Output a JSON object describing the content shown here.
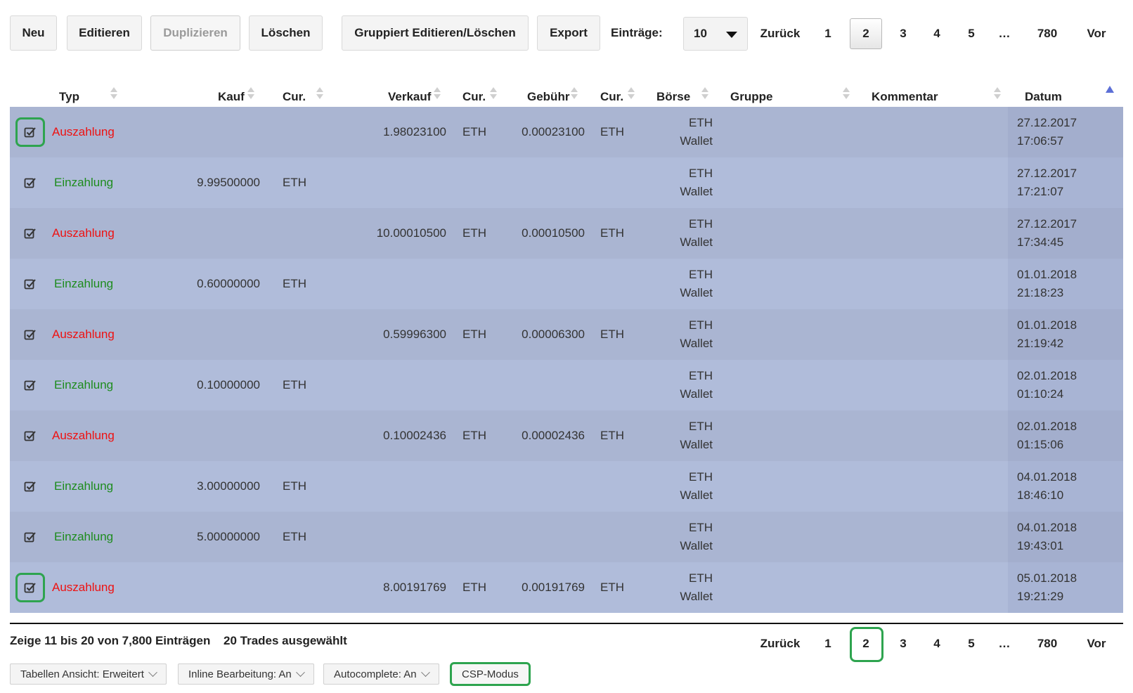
{
  "toolbar": {
    "new": "Neu",
    "edit": "Editieren",
    "duplicate": "Duplizieren",
    "delete": "Löschen",
    "group_edit": "Gruppiert Editieren/Löschen",
    "export": "Export",
    "entries_label": "Einträge:",
    "entries_value": "10"
  },
  "pagination": {
    "prev": "Zurück",
    "next": "Vor",
    "pages": [
      "1",
      "2",
      "3",
      "4",
      "5",
      "…",
      "780"
    ],
    "current": "2"
  },
  "columns": {
    "typ": "Typ",
    "kauf": "Kauf",
    "cur1": "Cur.",
    "verkauf": "Verkauf",
    "cur2": "Cur.",
    "gebuehr": "Gebühr",
    "cur3": "Cur.",
    "boerse": "Börse",
    "gruppe": "Gruppe",
    "kommentar": "Kommentar",
    "datum": "Datum"
  },
  "rows": [
    {
      "typ": "Auszahlung",
      "kauf": "",
      "cur1": "",
      "verkauf": "1.98023100",
      "cur2": "ETH",
      "gebuehr": "0.00023100",
      "cur3": "ETH",
      "boerse1": "ETH",
      "boerse2": "Wallet",
      "date": "27.12.2017",
      "time": "17:06:57"
    },
    {
      "typ": "Einzahlung",
      "kauf": "9.99500000",
      "cur1": "ETH",
      "verkauf": "",
      "cur2": "",
      "gebuehr": "",
      "cur3": "",
      "boerse1": "ETH",
      "boerse2": "Wallet",
      "date": "27.12.2017",
      "time": "17:21:07"
    },
    {
      "typ": "Auszahlung",
      "kauf": "",
      "cur1": "",
      "verkauf": "10.00010500",
      "cur2": "ETH",
      "gebuehr": "0.00010500",
      "cur3": "ETH",
      "boerse1": "ETH",
      "boerse2": "Wallet",
      "date": "27.12.2017",
      "time": "17:34:45"
    },
    {
      "typ": "Einzahlung",
      "kauf": "0.60000000",
      "cur1": "ETH",
      "verkauf": "",
      "cur2": "",
      "gebuehr": "",
      "cur3": "",
      "boerse1": "ETH",
      "boerse2": "Wallet",
      "date": "01.01.2018",
      "time": "21:18:23"
    },
    {
      "typ": "Auszahlung",
      "kauf": "",
      "cur1": "",
      "verkauf": "0.59996300",
      "cur2": "ETH",
      "gebuehr": "0.00006300",
      "cur3": "ETH",
      "boerse1": "ETH",
      "boerse2": "Wallet",
      "date": "01.01.2018",
      "time": "21:19:42"
    },
    {
      "typ": "Einzahlung",
      "kauf": "0.10000000",
      "cur1": "ETH",
      "verkauf": "",
      "cur2": "",
      "gebuehr": "",
      "cur3": "",
      "boerse1": "ETH",
      "boerse2": "Wallet",
      "date": "02.01.2018",
      "time": "01:10:24"
    },
    {
      "typ": "Auszahlung",
      "kauf": "",
      "cur1": "",
      "verkauf": "0.10002436",
      "cur2": "ETH",
      "gebuehr": "0.00002436",
      "cur3": "ETH",
      "boerse1": "ETH",
      "boerse2": "Wallet",
      "date": "02.01.2018",
      "time": "01:15:06"
    },
    {
      "typ": "Einzahlung",
      "kauf": "3.00000000",
      "cur1": "ETH",
      "verkauf": "",
      "cur2": "",
      "gebuehr": "",
      "cur3": "",
      "boerse1": "ETH",
      "boerse2": "Wallet",
      "date": "04.01.2018",
      "time": "18:46:10"
    },
    {
      "typ": "Einzahlung",
      "kauf": "5.00000000",
      "cur1": "ETH",
      "verkauf": "",
      "cur2": "",
      "gebuehr": "",
      "cur3": "",
      "boerse1": "ETH",
      "boerse2": "Wallet",
      "date": "04.01.2018",
      "time": "19:43:01"
    },
    {
      "typ": "Auszahlung",
      "kauf": "",
      "cur1": "",
      "verkauf": "8.00191769",
      "cur2": "ETH",
      "gebuehr": "0.00191769",
      "cur3": "ETH",
      "boerse1": "ETH",
      "boerse2": "Wallet",
      "date": "05.01.2018",
      "time": "19:21:29"
    }
  ],
  "footer": {
    "info": "Zeige 11 bis 20 von 7,800 Einträgen",
    "selected": "20 Trades ausgewählt",
    "view": "Tabellen Ansicht: Erweitert",
    "inline": "Inline Bearbeitung: An",
    "autocomplete": "Autocomplete: An",
    "csp": "CSP-Modus"
  },
  "colors": {
    "row_even": "#aab5d2",
    "row_odd": "#b0bcda",
    "withdrawal": "#ee1111",
    "deposit": "#1e8c1e",
    "highlight": "#2ea44f"
  }
}
